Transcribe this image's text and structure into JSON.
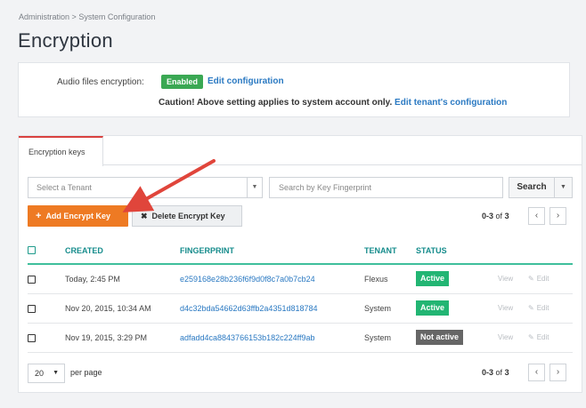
{
  "breadcrumb": {
    "items": [
      "Administration",
      "System Configuration"
    ],
    "separator": ">"
  },
  "page": {
    "title": "Encryption"
  },
  "settings": {
    "audio_label": "Audio files encryption:",
    "status_badge": "Enabled",
    "edit_link": "Edit configuration",
    "caution_text": "Caution! Above setting applies to system account only.",
    "tenant_link": "Edit tenant's configuration"
  },
  "tabs": [
    {
      "label": "Encryption keys",
      "active": true
    }
  ],
  "filters": {
    "tenant_placeholder": "Select a Tenant",
    "search_placeholder": "Search by Key Fingerprint",
    "search_button": "Search"
  },
  "toolbar": {
    "add_label": "Add Encrypt Key",
    "delete_label": "Delete Encrypt Key"
  },
  "pager": {
    "range": "0-3",
    "of": "of",
    "total": "3"
  },
  "table": {
    "headers": {
      "created": "CREATED",
      "fingerprint": "FINGERPRINT",
      "tenant": "TENANT",
      "status": "STATUS"
    },
    "rows": [
      {
        "created": "Today, 2:45 PM",
        "fingerprint": "e259168e28b236f6f9d0f8c7a0b7cb24",
        "tenant": "Flexus",
        "status": "Active",
        "view": "View",
        "edit": "Edit"
      },
      {
        "created": "Nov 20, 2015, 10:34 AM",
        "fingerprint": "d4c32bda54662d63ffb2a4351d818784",
        "tenant": "System",
        "status": "Active",
        "view": "View",
        "edit": "Edit"
      },
      {
        "created": "Nov 19, 2015, 3:29 PM",
        "fingerprint": "adfadd4ca8843766153b182c224ff9ab",
        "tenant": "System",
        "status": "Not active",
        "view": "View",
        "edit": "Edit"
      }
    ]
  },
  "per_page": {
    "value": "20",
    "label": "per page"
  },
  "colors": {
    "accent_orange": "#ee7a23",
    "teal": "#168c8c",
    "active_green": "#22b573",
    "link_blue": "#2a79c2",
    "tab_red": "#d9413f"
  },
  "icons": {
    "prev": "chevron-left-icon",
    "next": "chevron-right-icon",
    "plus": "plus-icon",
    "close": "close-icon",
    "edit": "pencil-icon"
  }
}
